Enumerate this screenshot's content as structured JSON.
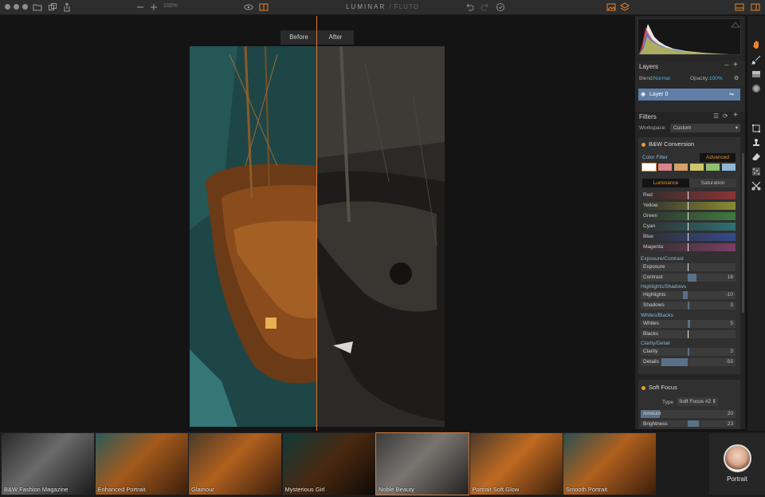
{
  "window": {
    "zoom_level": "100%",
    "title_main": "LUMINAR",
    "title_sub": "/ FLUTO"
  },
  "compare": {
    "before_label": "Before",
    "after_label": "After"
  },
  "layers": {
    "title": "Layers",
    "blend_label": "Blend:",
    "blend_value": "Normal",
    "opacity_label": "Opacity:",
    "opacity_value": "100%",
    "layer_name": "Layer 0"
  },
  "filters": {
    "title": "Filters",
    "workspace_label": "Workspace:",
    "workspace_value": "Custom",
    "bw": {
      "title": "B&W Conversion",
      "color_filter_label": "Color Filter",
      "advanced_label": "Advanced",
      "swatches": [
        "#ffffff",
        "#d9848a",
        "#d6a06a",
        "#cfc46a",
        "#8fbf72",
        "#8fb6d6"
      ],
      "luminance_label": "Luminance",
      "saturation_label": "Saturation",
      "color_sliders": [
        {
          "label": "Red",
          "color": "#8a3434"
        },
        {
          "label": "Yellow",
          "color": "#8a8a34"
        },
        {
          "label": "Green",
          "color": "#3f7a3f"
        },
        {
          "label": "Cyan",
          "color": "#2f6f72"
        },
        {
          "label": "Blue",
          "color": "#35498a"
        },
        {
          "label": "Magenta",
          "color": "#7a3f62"
        }
      ],
      "groups": {
        "exposure_contrast": "Exposure/Contrast",
        "highlights_shadows": "Highlights/Shadows",
        "whites_blacks": "Whites/Blacks",
        "clarity_detail": "Clarity/Detail"
      },
      "sliders": {
        "exposure": {
          "label": "Exposure",
          "value": ""
        },
        "contrast": {
          "label": "Contrast",
          "value": "18"
        },
        "highlights": {
          "label": "Highlights",
          "value": "-10"
        },
        "shadows": {
          "label": "Shadows",
          "value": "3"
        },
        "whites": {
          "label": "Whites",
          "value": "5"
        },
        "blacks": {
          "label": "Blacks",
          "value": ""
        },
        "clarity": {
          "label": "Clarity",
          "value": "3"
        },
        "details": {
          "label": "Details",
          "value": "-55"
        }
      }
    },
    "soft_focus": {
      "title": "Soft Focus",
      "type_label": "Type",
      "type_value": "Soft Focus #2",
      "amount": {
        "label": "Amount",
        "value": "20"
      },
      "brightness": {
        "label": "Brightness",
        "value": "23"
      }
    }
  },
  "presets": [
    "B&W Fashion Magazine",
    "Enhanced Portrait",
    "Glamour",
    "Mysterious Girl",
    "Noble Beauty",
    "Portrait Soft Glow",
    "Smooth Portrait"
  ],
  "preset_category": "Portrait",
  "colors": {
    "accent_orange": "#e8842f",
    "accent_blue": "#4fb3d9",
    "layer_selected": "#5f7fa6"
  }
}
